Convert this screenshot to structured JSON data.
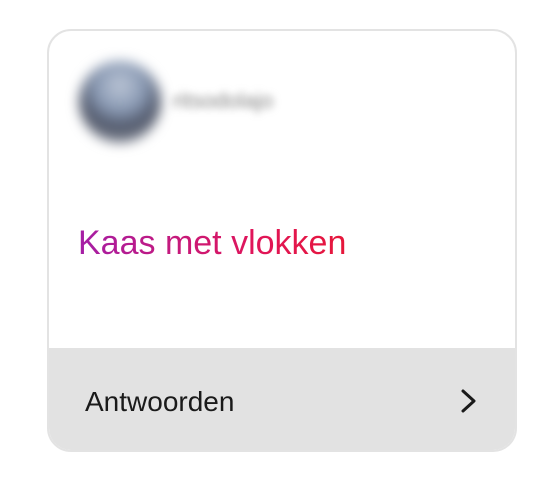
{
  "sender": {
    "name": "ritsodolajo"
  },
  "message": {
    "text": "Kaas met vlokken",
    "gradient_start": "#a41ea6",
    "gradient_end": "#e6173a"
  },
  "reply": {
    "label": "Antwoorden",
    "icon": "chevron-right-icon"
  }
}
